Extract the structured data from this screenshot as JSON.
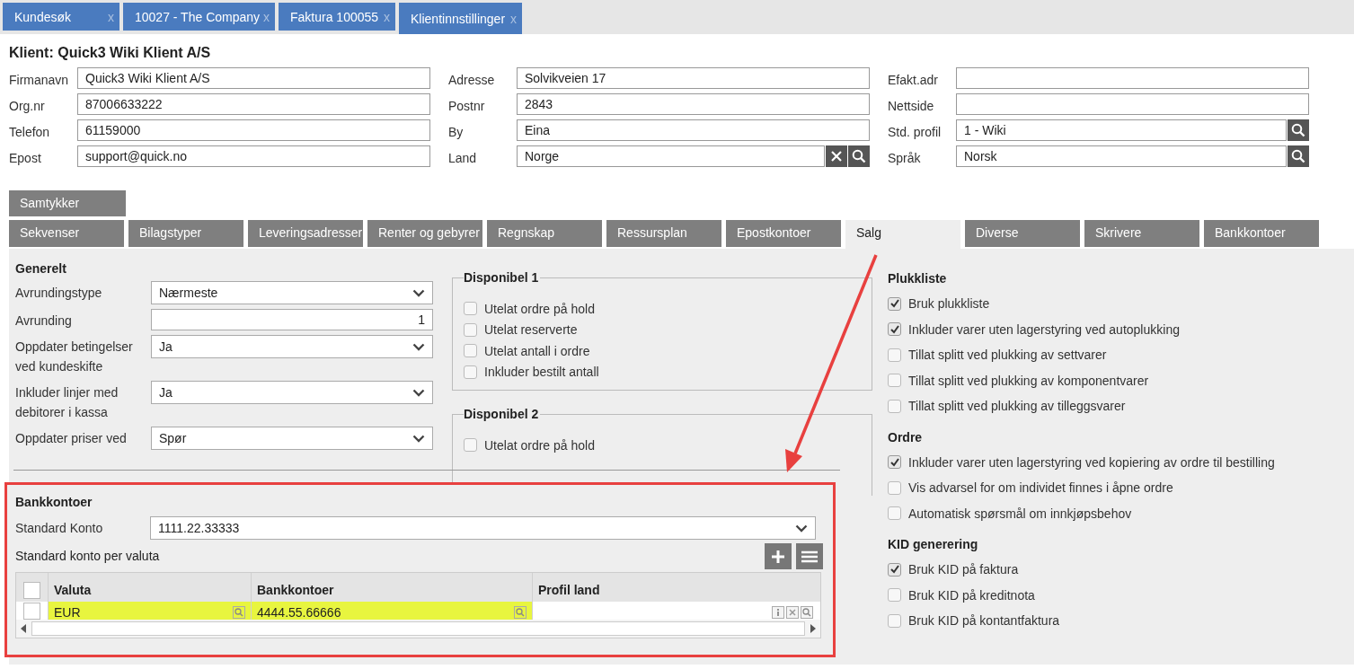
{
  "tabs": [
    {
      "label": "Kundesøk",
      "close": "x",
      "selected": false
    },
    {
      "label": "10027 - The Company",
      "close": "x",
      "selected": false
    },
    {
      "label": "Faktura 100055",
      "close": "x",
      "selected": false
    },
    {
      "label": "Klientinnstillinger",
      "close": "x",
      "selected": true
    }
  ],
  "title": "Klient: Quick3 Wiki Klient A/S",
  "field_columns": [
    [
      {
        "label": "Firmanavn",
        "value": "Quick3 Wiki Klient A/S"
      },
      {
        "label": "Org.nr",
        "value": "87006633222"
      },
      {
        "label": "Telefon",
        "value": "61159000"
      },
      {
        "label": "Epost",
        "value": "support@quick.no"
      }
    ],
    [
      {
        "label": "Adresse",
        "value": "Solvikveien 17"
      },
      {
        "label": "Postnr",
        "value": "2843"
      },
      {
        "label": "By",
        "value": "Eina"
      },
      {
        "label": "Land",
        "value": "Norge",
        "actions": [
          {
            "kind": "clear"
          },
          {
            "kind": "search"
          }
        ]
      }
    ],
    [
      {
        "label": "Efakt.adr"
      },
      {
        "label": "Nettside"
      },
      {
        "label": "Std. profil",
        "value": "1 - Wiki",
        "actions": [
          {
            "kind": "search"
          }
        ]
      },
      {
        "label": "Språk",
        "value": "Norsk",
        "actions": [
          {
            "kind": "search"
          }
        ]
      }
    ]
  ],
  "settings_tabs_row1": [
    {
      "label": "Samtykker",
      "selected": false
    }
  ],
  "settings_tabs_row2": [
    {
      "label": "Sekvenser",
      "selected": false
    },
    {
      "label": "Bilagstyper",
      "selected": false
    },
    {
      "label": "Leveringsadresser",
      "selected": false
    },
    {
      "label": "Renter og gebyrer",
      "selected": false
    },
    {
      "label": "Regnskap",
      "selected": false
    },
    {
      "label": "Ressursplan",
      "selected": false
    },
    {
      "label": "Epostkontoer",
      "selected": false
    },
    {
      "label": "Salg",
      "selected": true
    },
    {
      "label": "Diverse",
      "selected": false
    },
    {
      "label": "Skrivere",
      "selected": false
    },
    {
      "label": "Bankkontoer",
      "selected": false
    }
  ],
  "generelt": {
    "title": "Generelt",
    "rows": [
      {
        "kind": "select",
        "label": "Avrundingstype",
        "value": "Nærmeste"
      },
      {
        "kind": "number",
        "label": "Avrunding",
        "value": "1"
      },
      {
        "kind": "select",
        "label": "Oppdater betingelser ved kundeskifte",
        "value": "Ja"
      },
      {
        "kind": "select",
        "label": "Inkluder linjer med debitorer i kassa",
        "value": "Ja"
      },
      {
        "kind": "select",
        "label": "Oppdater priser ved",
        "value": "Spør"
      }
    ]
  },
  "fieldsets": [
    {
      "title": "Disponibel 1",
      "options": [
        {
          "label": "Utelat ordre på hold",
          "checked": false
        },
        {
          "label": "Utelat reserverte",
          "checked": false
        },
        {
          "label": "Utelat antall i ordre",
          "checked": false
        },
        {
          "label": "Inkluder bestilt antall",
          "checked": false
        }
      ]
    },
    {
      "title": "Disponibel 2",
      "options": [
        {
          "label": "Utelat ordre på hold",
          "checked": false
        }
      ]
    }
  ],
  "right_sections": [
    {
      "title": "Plukkliste",
      "options": [
        {
          "label": "Bruk plukkliste",
          "checked": true
        },
        {
          "label": "Inkluder varer uten lagerstyring ved autoplukking",
          "checked": true
        },
        {
          "label": "Tillat splitt ved plukking av settvarer",
          "checked": false
        },
        {
          "label": "Tillat splitt ved plukking av komponentvarer",
          "checked": false
        },
        {
          "label": "Tillat splitt ved plukking av tilleggsvarer",
          "checked": false
        }
      ]
    },
    {
      "title": "Ordre",
      "options": [
        {
          "label": "Inkluder varer uten lagerstyring ved kopiering av ordre til bestilling",
          "checked": true
        },
        {
          "label": "Vis advarsel for om individet finnes i åpne ordre",
          "checked": false
        },
        {
          "label": "Automatisk spørsmål om innkjøpsbehov",
          "checked": false
        }
      ]
    },
    {
      "title": "KID generering",
      "options": [
        {
          "label": "Bruk KID på faktura",
          "checked": true
        },
        {
          "label": "Bruk KID på kreditnota",
          "checked": false
        },
        {
          "label": "Bruk KID på kontantfaktura",
          "checked": false
        }
      ]
    }
  ],
  "bank_panel": {
    "title": "Bankkontoer",
    "standard_label": "Standard Konto",
    "standard_value": "1111.22.33333",
    "subtitle": "Standard konto per valuta",
    "columns": [
      "Valuta",
      "Bankkontoer",
      "Profil land"
    ],
    "all_checked": false,
    "rows": [
      {
        "checked": false,
        "valuta": "EUR",
        "bankkonto": "4444.55.66666",
        "highlighted": true
      }
    ]
  }
}
